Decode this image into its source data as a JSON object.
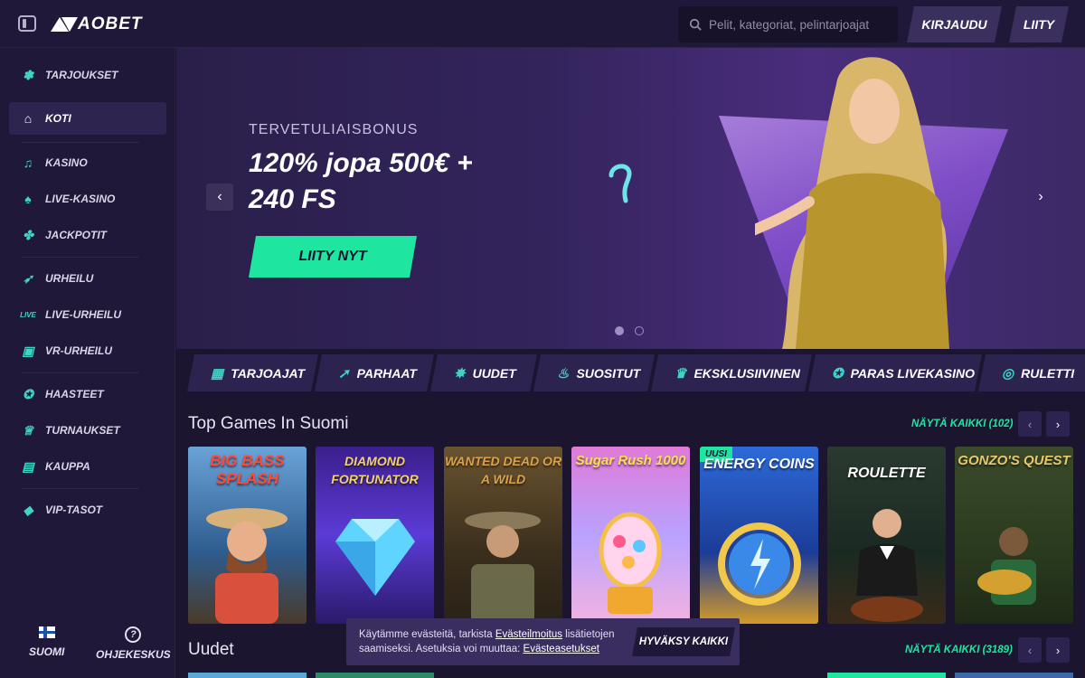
{
  "brand": {
    "name": "AOBET",
    "accent": "#1ee6a0",
    "secondary": "#3fd5c5"
  },
  "header": {
    "search_placeholder": "Pelit, kategoriat, pelintarjoajat",
    "login_label": "KIRJAUDU",
    "join_label": "LIITY"
  },
  "sidebar": {
    "items": [
      {
        "label": "TARJOUKSET",
        "icon": "offers-icon"
      },
      {
        "label": "KOTI",
        "icon": "home-icon"
      },
      {
        "label": "KASINO",
        "icon": "casino-icon"
      },
      {
        "label": "LIVE-KASINO",
        "icon": "live-casino-icon"
      },
      {
        "label": "JACKPOTIT",
        "icon": "jackpot-icon"
      },
      {
        "label": "URHEILU",
        "icon": "sports-icon"
      },
      {
        "label": "LIVE-URHEILU",
        "icon": "live-sports-icon"
      },
      {
        "label": "VR-URHEILU",
        "icon": "vr-sports-icon"
      },
      {
        "label": "HAASTEET",
        "icon": "challenges-icon"
      },
      {
        "label": "TURNAUKSET",
        "icon": "trophy-icon"
      },
      {
        "label": "KAUPPA",
        "icon": "shop-icon"
      },
      {
        "label": "VIP-TASOT",
        "icon": "diamond-icon"
      }
    ],
    "language_label": "SUOMI",
    "help_label": "OHJEKESKUS"
  },
  "hero": {
    "subtitle": "TERVETULIAISBONUS",
    "title": "120% jopa 500€ + 240 FS",
    "cta_label": "LIITY NYT",
    "slide_count": 2,
    "active_slide": 1
  },
  "categories": [
    {
      "label": "TARJOAJAT",
      "icon": "grid-icon"
    },
    {
      "label": "PARHAAT",
      "icon": "rocket-icon"
    },
    {
      "label": "UUDET",
      "icon": "new-icon"
    },
    {
      "label": "SUOSITUT",
      "icon": "fire-icon"
    },
    {
      "label": "EKSKLUSIIVINEN",
      "icon": "crown-icon"
    },
    {
      "label": "PARAS LIVEKASINO",
      "icon": "star-icon"
    },
    {
      "label": "RULETTI",
      "icon": "roulette-icon"
    }
  ],
  "sections": {
    "top": {
      "title": "Top Games In Suomi",
      "see_all": "NÄYTÄ KAIKKI (102)"
    },
    "new": {
      "title": "Uudet",
      "see_all": "NÄYTÄ KAIKKI (3189)"
    }
  },
  "games": [
    {
      "name": "BIG BASS SPLASH",
      "badge": "",
      "bg": "#3f77b8"
    },
    {
      "name": "DIAMOND FORTUNATOR",
      "badge": "",
      "bg": "#3d2399"
    },
    {
      "name": "WANTED DEAD OR A WILD",
      "badge": "",
      "bg": "#5a4424"
    },
    {
      "name": "Sugar Rush 1000",
      "badge": "",
      "bg": "#c06bd8"
    },
    {
      "name": "ENERGY COINS",
      "badge": "UUSI",
      "bg": "#1f4fa8"
    },
    {
      "name": "ROULETTE",
      "badge": "",
      "bg": "#1e3a2a"
    },
    {
      "name": "GONZO'S QUEST",
      "badge": "",
      "bg": "#2f4a2a"
    }
  ],
  "cookie": {
    "text_part1": "Käytämme evästeitä, tarkista ",
    "link1": "Evästeilmoitus",
    "text_part2": " lisätietojen saamiseksi. Asetuksia voi muuttaa: ",
    "link2": "Evästeasetukset",
    "accept_label": "HYVÄKSY KAIKKI"
  }
}
